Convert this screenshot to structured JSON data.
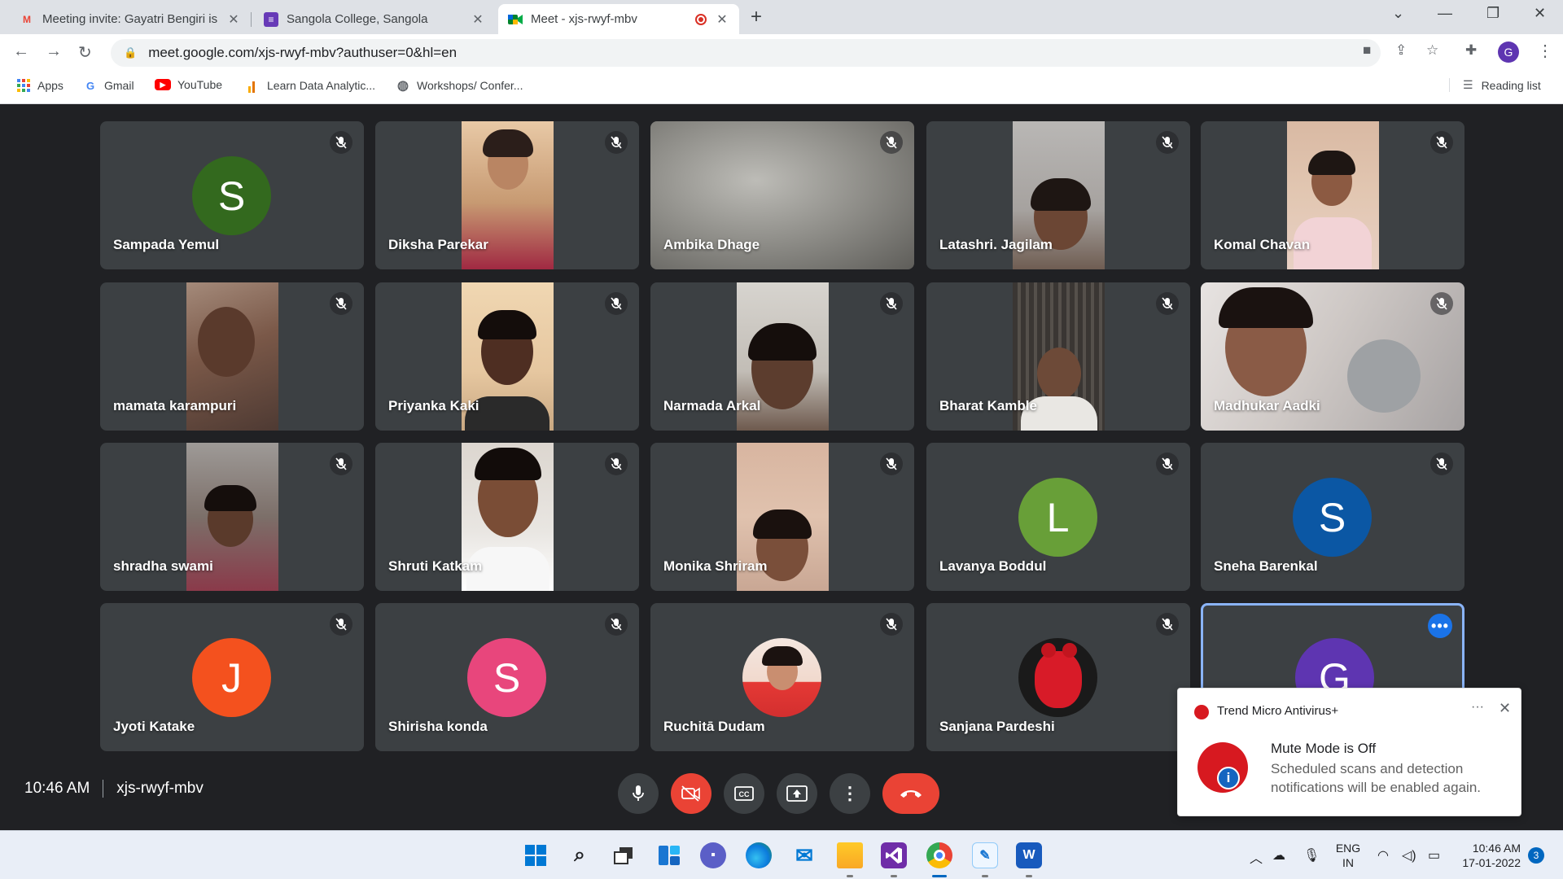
{
  "browser": {
    "tabs": [
      {
        "title": "Meeting invite: Gayatri Bengiri is",
        "icon": "gmail-icon"
      },
      {
        "title": "Sangola College, Sangola",
        "icon": "forms-icon"
      },
      {
        "title": "Meet - xjs-rwyf-mbv",
        "icon": "meet-icon",
        "recording": true
      }
    ],
    "new_tab_label": "+",
    "url": "meet.google.com/xjs-rwyf-mbv?authuser=0&hl=en",
    "profile_initial": "G",
    "bookmarks": [
      {
        "label": "Apps",
        "icon": "apps-grid-icon"
      },
      {
        "label": "Gmail",
        "icon": "google-g-icon"
      },
      {
        "label": "YouTube",
        "icon": "youtube-icon"
      },
      {
        "label": "Learn Data Analytic...",
        "icon": "analytics-icon"
      },
      {
        "label": "Workshops/ Confer...",
        "icon": "globe-icon"
      }
    ],
    "reading_list_label": "Reading list"
  },
  "meeting": {
    "time": "10:46 AM",
    "code": "xjs-rwyf-mbv",
    "participants": [
      {
        "name": "Sampada Yemul",
        "kind": "avatar",
        "initial": "S",
        "color": "#33691e"
      },
      {
        "name": "Diksha Parekar",
        "kind": "video"
      },
      {
        "name": "Ambika Dhage",
        "kind": "video"
      },
      {
        "name": "Latashri. Jagilam",
        "kind": "video"
      },
      {
        "name": "Komal Chavan",
        "kind": "video"
      },
      {
        "name": "mamata karampuri",
        "kind": "video"
      },
      {
        "name": "Priyanka Kaki",
        "kind": "video"
      },
      {
        "name": "Narmada Arkal",
        "kind": "video"
      },
      {
        "name": "Bharat Kamble",
        "kind": "video"
      },
      {
        "name": "Madhukar Aadki",
        "kind": "video"
      },
      {
        "name": "shradha swami",
        "kind": "video"
      },
      {
        "name": "Shruti Katkam",
        "kind": "video"
      },
      {
        "name": "Monika Shriram",
        "kind": "video"
      },
      {
        "name": "Lavanya Boddul",
        "kind": "avatar",
        "initial": "L",
        "color": "#689f38"
      },
      {
        "name": "Sneha Barenkal",
        "kind": "avatar",
        "initial": "S",
        "color": "#0b57a4"
      },
      {
        "name": "Jyoti Katake",
        "kind": "avatar",
        "initial": "J",
        "color": "#f4511e"
      },
      {
        "name": "Shirisha konda",
        "kind": "avatar",
        "initial": "S",
        "color": "#e8467c"
      },
      {
        "name": "Ruchitā Dudam",
        "kind": "photo"
      },
      {
        "name": "Sanjana Pardeshi",
        "kind": "photo"
      },
      {
        "name": "",
        "kind": "self",
        "initial": "G",
        "color": "#5e35b1"
      }
    ]
  },
  "notification": {
    "app": "Trend Micro Antivirus+",
    "title": "Mute Mode is Off",
    "body": "Scheduled scans and detection notifications will be enabled again."
  },
  "taskbar": {
    "language": "ENG",
    "region": "IN",
    "time": "10:46 AM",
    "date": "17-01-2022",
    "notification_count": "3"
  },
  "colors": {
    "meet_bg": "#202124",
    "tile_bg": "#3c4043",
    "leave_red": "#ea4335",
    "accent_blue": "#1a73e8"
  }
}
